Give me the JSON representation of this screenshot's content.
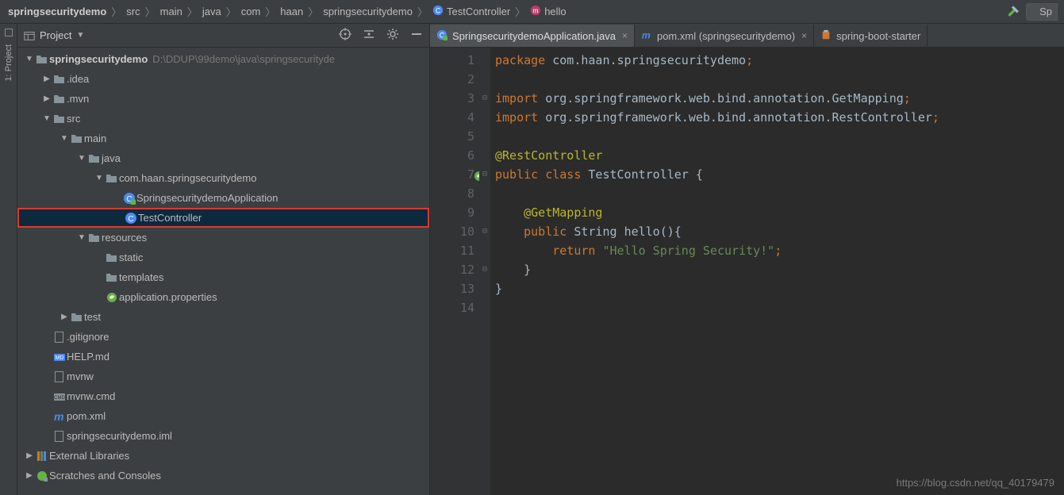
{
  "breadcrumbs": [
    {
      "label": "springsecuritydemo",
      "bold": true,
      "icon": ""
    },
    {
      "label": "src",
      "icon": ""
    },
    {
      "label": "main",
      "icon": ""
    },
    {
      "label": "java",
      "icon": ""
    },
    {
      "label": "com",
      "icon": ""
    },
    {
      "label": "haan",
      "icon": ""
    },
    {
      "label": "springsecuritydemo",
      "icon": ""
    },
    {
      "label": "TestController",
      "icon": "class"
    },
    {
      "label": "hello",
      "icon": "method"
    }
  ],
  "run_fragment": "Sp",
  "left_tab": "1: Project",
  "sidebar": {
    "title": "Project",
    "tree": [
      {
        "depth": 0,
        "arrow": "open",
        "icon": "folder",
        "label": "springsecuritydemo",
        "bold": true,
        "extra": "D:\\DDUP\\99demo\\java\\springsecurityde"
      },
      {
        "depth": 1,
        "arrow": "closed",
        "icon": "folder",
        "label": ".idea"
      },
      {
        "depth": 1,
        "arrow": "closed",
        "icon": "folder",
        "label": ".mvn"
      },
      {
        "depth": 1,
        "arrow": "open",
        "icon": "folder",
        "label": "src"
      },
      {
        "depth": 2,
        "arrow": "open",
        "icon": "folder",
        "label": "main"
      },
      {
        "depth": 3,
        "arrow": "open",
        "icon": "folder",
        "label": "java"
      },
      {
        "depth": 4,
        "arrow": "open",
        "icon": "folder",
        "label": "com.haan.springsecuritydemo"
      },
      {
        "depth": 5,
        "arrow": "none",
        "icon": "spring-class",
        "label": "SpringsecuritydemoApplication"
      },
      {
        "depth": 5,
        "arrow": "none",
        "icon": "class",
        "label": "TestController",
        "selected": true,
        "boxed": true
      },
      {
        "depth": 3,
        "arrow": "open",
        "icon": "folder",
        "label": "resources"
      },
      {
        "depth": 4,
        "arrow": "none",
        "icon": "folder",
        "label": "static"
      },
      {
        "depth": 4,
        "arrow": "none",
        "icon": "folder",
        "label": "templates"
      },
      {
        "depth": 4,
        "arrow": "none",
        "icon": "spring-file",
        "label": "application.properties"
      },
      {
        "depth": 2,
        "arrow": "closed",
        "icon": "folder",
        "label": "test"
      },
      {
        "depth": 1,
        "arrow": "none",
        "icon": "file",
        "label": ".gitignore"
      },
      {
        "depth": 1,
        "arrow": "none",
        "icon": "md",
        "label": "HELP.md"
      },
      {
        "depth": 1,
        "arrow": "none",
        "icon": "file",
        "label": "mvnw"
      },
      {
        "depth": 1,
        "arrow": "none",
        "icon": "cmd",
        "label": "mvnw.cmd"
      },
      {
        "depth": 1,
        "arrow": "none",
        "icon": "maven",
        "label": "pom.xml"
      },
      {
        "depth": 1,
        "arrow": "none",
        "icon": "file",
        "label": "springsecuritydemo.iml"
      },
      {
        "depth": 0,
        "arrow": "closed",
        "icon": "lib",
        "label": "External Libraries"
      },
      {
        "depth": 0,
        "arrow": "closed",
        "icon": "scratch",
        "label": "Scratches and Consoles"
      }
    ]
  },
  "tabs": [
    {
      "label": "SpringsecuritydemoApplication.java",
      "icon": "spring-class",
      "active": true,
      "closable": true
    },
    {
      "label": "pom.xml (springsecuritydemo)",
      "icon": "maven",
      "closable": true
    },
    {
      "label": "spring-boot-starter",
      "icon": "jar",
      "closable": false
    }
  ],
  "editor": {
    "lines": [
      {
        "n": 1,
        "cls": "",
        "html": "<span class='kw'>package</span> <span class='pkg'>com.haan.springsecuritydemo</span><span class='semi'>;</span>"
      },
      {
        "n": 2,
        "html": ""
      },
      {
        "n": 3,
        "fold": "⊟",
        "html": "<span class='kw'>import</span> <span class='impA'>org.springframework.web.bind.annotation.</span><span class='cls'>GetMapping</span><span class='semi'>;</span>"
      },
      {
        "n": 4,
        "fold": "",
        "html": "<span class='kw'>import</span> <span class='impA'>org.springframework.web.bind.annotation.</span><span class='cls'>RestController</span><span class='semi'>;</span>"
      },
      {
        "n": 5,
        "html": ""
      },
      {
        "n": 6,
        "html": "<span class='ann'>@RestController</span>"
      },
      {
        "n": 7,
        "mark": "spring",
        "fold": "⊟",
        "html": "<span class='kw'>public class</span> TestController {"
      },
      {
        "n": 8,
        "html": ""
      },
      {
        "n": 9,
        "html": "    <span class='ann'>@GetMapping</span>"
      },
      {
        "n": 10,
        "fold": "⊟",
        "html": "    <span class='kw'>public</span> String <span>hello</span>(){"
      },
      {
        "n": 11,
        "html": "        <span class='kw'>return</span> <span class='str'>\"Hello Spring Security!\"</span><span class='semi'>;</span>"
      },
      {
        "n": 12,
        "fold": "⊟",
        "html": "    }"
      },
      {
        "n": 13,
        "html": "}"
      },
      {
        "n": 14,
        "html": ""
      }
    ]
  },
  "watermark": "https://blog.csdn.net/qq_40179479"
}
